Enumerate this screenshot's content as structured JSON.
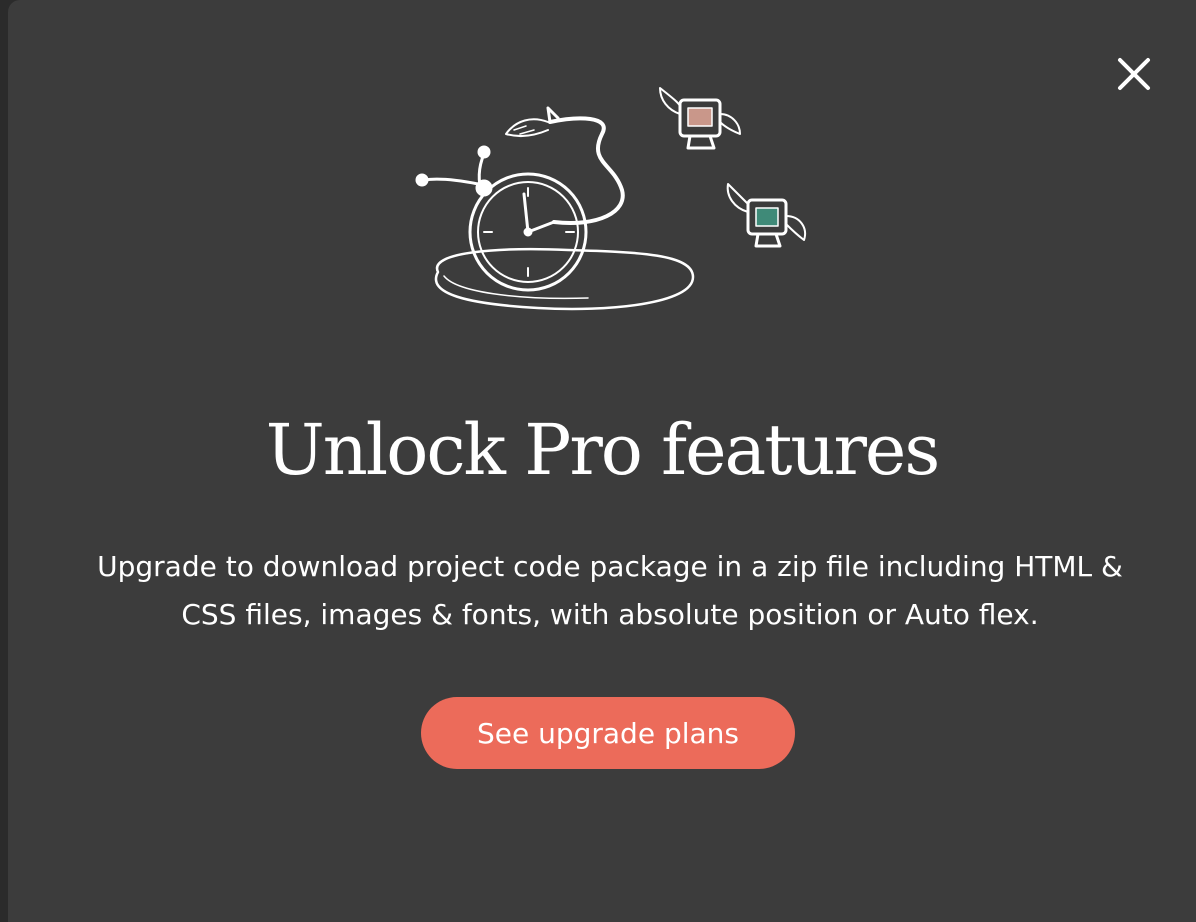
{
  "modal": {
    "title": "Unlock Pro features",
    "description": "Upgrade to download project code package in a zip file including HTML & CSS files, images & fonts, with absolute position or Auto flex.",
    "cta_label": "See upgrade plans",
    "close_icon": "close-icon",
    "illustration_icon": "flying-clock-illustration"
  },
  "colors": {
    "backdrop": "#2b2b2b",
    "modal_background": "#3c3c3c",
    "accent": "#ec6b5a",
    "text": "#ffffff"
  }
}
